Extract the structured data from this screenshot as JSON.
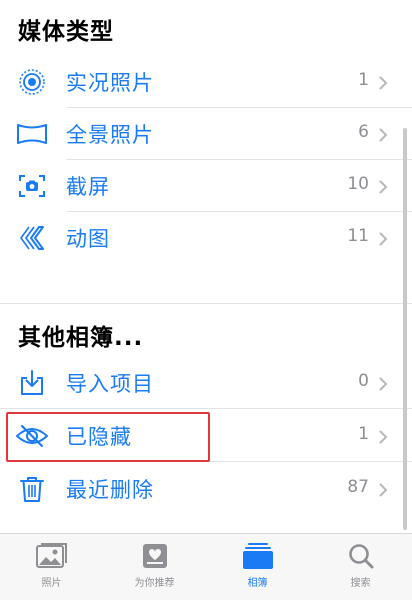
{
  "media_types": {
    "title": "媒体类型",
    "items": [
      {
        "label": "实况照片",
        "count": "1",
        "icon": "live-photo-icon"
      },
      {
        "label": "全景照片",
        "count": "6",
        "icon": "panorama-icon"
      },
      {
        "label": "截屏",
        "count": "10",
        "icon": "screenshot-icon"
      },
      {
        "label": "动图",
        "count": "11",
        "icon": "animated-icon"
      }
    ]
  },
  "other_albums": {
    "title": "其他相簿...",
    "items": [
      {
        "label": "导入项目",
        "count": "0",
        "icon": "import-icon"
      },
      {
        "label": "已隐藏",
        "count": "1",
        "icon": "hidden-eye-icon",
        "highlighted": true
      },
      {
        "label": "最近删除",
        "count": "87",
        "icon": "trash-icon"
      }
    ]
  },
  "tabbar": {
    "tabs": [
      {
        "label": "照片",
        "icon": "photos-tab-icon",
        "active": false
      },
      {
        "label": "为你推荐",
        "icon": "for-you-tab-icon",
        "active": false
      },
      {
        "label": "相簿",
        "icon": "albums-tab-icon",
        "active": true
      },
      {
        "label": "搜索",
        "icon": "search-tab-icon",
        "active": false
      }
    ]
  },
  "colors": {
    "accent": "#1a7cf5",
    "highlight_border": "#e0363c",
    "secondary_text": "#8e8e93"
  }
}
